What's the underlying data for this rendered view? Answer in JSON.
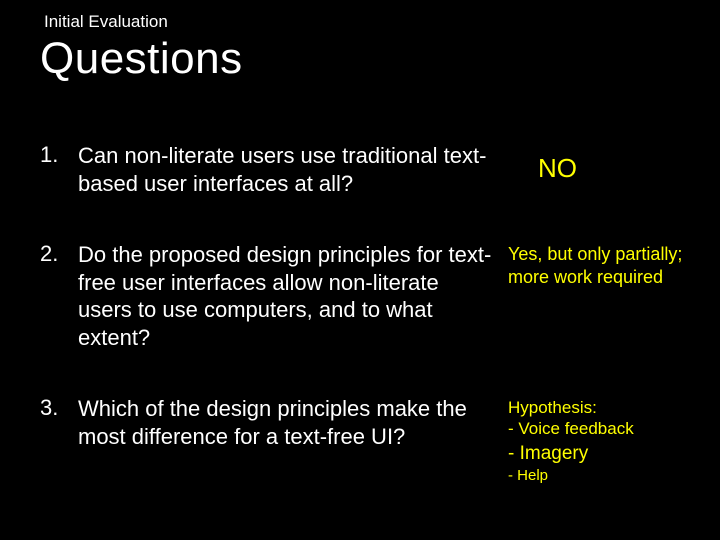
{
  "kicker": "Initial Evaluation",
  "title": "Questions",
  "items": [
    {
      "num": "1.",
      "text": "Can non-literate users use traditional text-based user interfaces at all?",
      "answer_big": "NO"
    },
    {
      "num": "2.",
      "text": "Do the proposed design principles for text-free user interfaces allow non-literate users to use computers, and to what extent?",
      "answer": "Yes, but only partially; more work required"
    },
    {
      "num": "3.",
      "text": "Which of the design principles make the most difference for a text-free UI?",
      "answer_lines": {
        "l1": "Hypothesis:",
        "l2": "- Voice feedback",
        "l3": "- Imagery",
        "l4": "- Help"
      }
    }
  ]
}
